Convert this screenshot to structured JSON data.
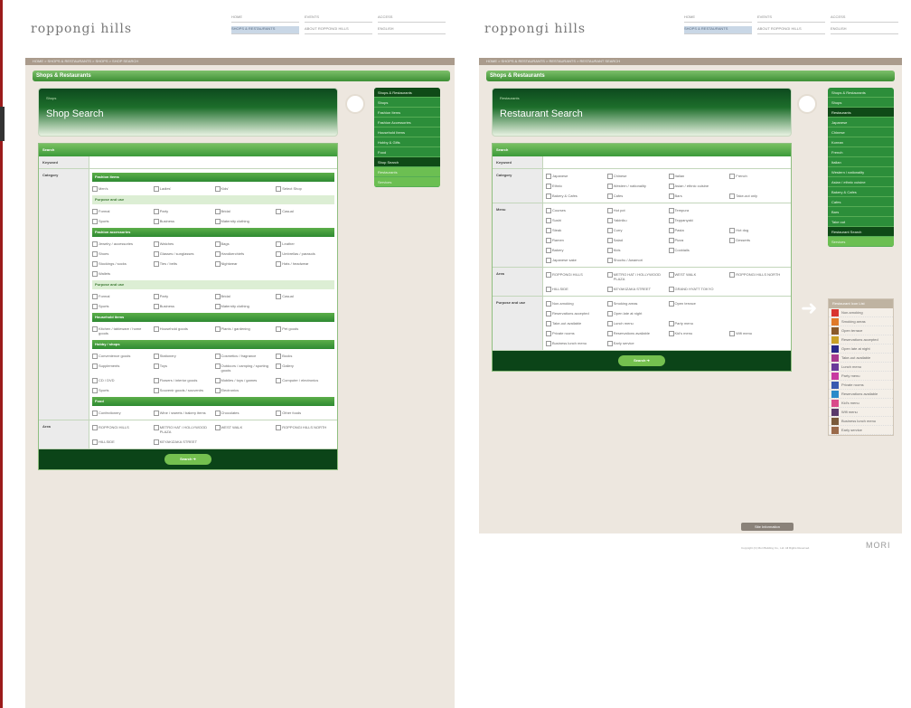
{
  "pageA": {
    "logo": "roppongi hills",
    "topnav": [
      "HOME",
      "EVENTS",
      "ACCESS",
      "SHOPS & RESTAURANTS",
      "ABOUT ROPPONGI HILLS",
      "ENGLISH"
    ],
    "breadcrumb": "HOME > SHOPS & RESTAURANTS > SHOPS > SHOP SEARCH",
    "band": "Shops & Restaurants",
    "hero_crumb": "Shops",
    "hero_title": "Shop Search",
    "menu": [
      {
        "label": "Shops & Restaurants",
        "state": "sel"
      },
      {
        "label": "Shops",
        "state": ""
      },
      {
        "label": "Fashion Items",
        "state": ""
      },
      {
        "label": "Fashion Accessories",
        "state": ""
      },
      {
        "label": "Household Items",
        "state": ""
      },
      {
        "label": "Hobby & Gifts",
        "state": ""
      },
      {
        "label": "Food",
        "state": ""
      },
      {
        "label": "Shop Search",
        "state": "sel"
      },
      {
        "label": "Restaurants",
        "state": "alt"
      },
      {
        "label": "Services",
        "state": "alt"
      }
    ],
    "form_head": "Search",
    "keyword_label": "Keyword",
    "category_label": "Category",
    "area_label": "Area",
    "groups": [
      {
        "name": "Fashion items",
        "light": false,
        "items": [
          "Men's",
          "Ladies'",
          "Kids'",
          "Select Shop"
        ]
      },
      {
        "name": "Purpose and use",
        "light": true,
        "items": [
          "Formal",
          "Party",
          "Bridal",
          "Casual",
          "Sports",
          "Business",
          "Maternity clothing"
        ]
      },
      {
        "name": "Fashion accessories",
        "light": false,
        "items": [
          "Jewelry / accessories",
          "Watches",
          "Bags",
          "Leather",
          "Shoes",
          "Glasses / sunglasses",
          "Handkerchiefs",
          "Umbrellas / parasols",
          "Stockings / socks",
          "Ties / belts",
          "Nightwear",
          "Hats / headwear",
          "Wallets"
        ]
      },
      {
        "name": "Purpose and use",
        "light": true,
        "items": [
          "Formal",
          "Party",
          "Bridal",
          "Casual",
          "Sports",
          "Business",
          "Maternity clothing"
        ]
      },
      {
        "name": "Household items",
        "light": false,
        "items": [
          "Kitchen / tableware / home goods",
          "Household goods",
          "Plants / gardening",
          "Pet goods"
        ]
      },
      {
        "name": "Hobby / shops",
        "light": false,
        "items": [
          "Convenience goods",
          "Stationery",
          "Cosmetics / fragrance",
          "Books",
          "Supplements",
          "Toys",
          "Outdoors / camping / sporting goods",
          "Gallery",
          "CD / DVD",
          "Flowers / interior goods",
          "Mobiles / toys / games",
          "Computer / electronics",
          "Sports",
          "Souvenir goods / souvenirs",
          "Electronics"
        ]
      },
      {
        "name": "Food",
        "light": false,
        "items": [
          "Confectionery",
          "Wine / sweets / bakery items",
          "Chocolates",
          "Other foods"
        ]
      }
    ],
    "areas": [
      "ROPPONGI HILLS",
      "METRO HAT / HOLLYWOOD PLAZA",
      "WEST WALK",
      "ROPPONGI HILLS NORTH",
      "HILLSIDE",
      "KEYAKIZAKA STREET"
    ],
    "search_btn": "Search  ➔"
  },
  "pageB": {
    "logo": "roppongi hills",
    "topnav": [
      "HOME",
      "EVENTS",
      "ACCESS",
      "SHOPS & RESTAURANTS",
      "ABOUT ROPPONGI HILLS",
      "ENGLISH"
    ],
    "breadcrumb": "HOME > SHOPS & RESTAURANTS > RESTAURANTS > RESTAURANT SEARCH",
    "band": "Shops & Restaurants",
    "hero_crumb": "Restaurants",
    "hero_title": "Restaurant Search",
    "menu": [
      {
        "label": "Shops & Restaurants",
        "state": ""
      },
      {
        "label": "Shops",
        "state": ""
      },
      {
        "label": "Restaurants",
        "state": "sel"
      },
      {
        "label": "Japanese",
        "state": ""
      },
      {
        "label": "Chinese",
        "state": ""
      },
      {
        "label": "Korean",
        "state": ""
      },
      {
        "label": "French",
        "state": ""
      },
      {
        "label": "Italian",
        "state": ""
      },
      {
        "label": "Western / nationality",
        "state": ""
      },
      {
        "label": "Asian / ethnic cuisine",
        "state": ""
      },
      {
        "label": "Bakery & Cafes",
        "state": ""
      },
      {
        "label": "Cafes",
        "state": ""
      },
      {
        "label": "Bars",
        "state": ""
      },
      {
        "label": "Take out",
        "state": ""
      },
      {
        "label": "Restaurant Search",
        "state": "sel"
      },
      {
        "label": "Services",
        "state": "alt"
      }
    ],
    "form_head": "Search",
    "keyword_label": "Keyword",
    "category_label": "Category",
    "menu_label": "Menu",
    "area_label": "Area",
    "purpose_label": "Purpose and use",
    "categories": [
      "Japanese",
      "Chinese",
      "Italian",
      "French",
      "Ethnic",
      "Western / nationality",
      "Asian / ethnic cuisine",
      "",
      "Bakery & Cafes",
      "Cafes",
      "Bars",
      "Take-out only"
    ],
    "menus": [
      "Courses",
      "Hot pot",
      "Tempura",
      "",
      "Sushi",
      "Yakiniku",
      "Teppanyaki",
      "",
      "Steak",
      "Curry",
      "Pasta",
      "Hot dog",
      "Ramen",
      "Salad",
      "Pizza",
      "Desserts",
      "Bakery",
      "Kids",
      "Cocktails",
      "",
      "Japanese sake",
      "Shochu / Awamori",
      "",
      ""
    ],
    "areas": [
      "ROPPONGI HILLS",
      "METRO HAT / HOLLYWOOD PLAZA",
      "WEST WALK",
      "ROPPONGI HILLS NORTH",
      "HILLSIDE",
      "KEYAKIZAKA STREET",
      "GRAND HYATT TOKYO",
      ""
    ],
    "purposes": [
      "Non-smoking",
      "Smoking areas",
      "Open terrace",
      "",
      "Reservations accepted",
      "Open late at night",
      "",
      "",
      "Take-out available",
      "Lunch menu",
      "Party menu",
      "",
      "Private rooms",
      "Reservations available",
      "Kid's menu",
      "Wifi menu",
      "Business lunch menu",
      "Early service",
      "",
      ""
    ],
    "search_btn": "Search  ➔",
    "legend_head": "Restaurant Icon List",
    "legend": [
      {
        "label": "Non-smoking",
        "color": "#d9352f"
      },
      {
        "label": "Smoking areas",
        "color": "#e07a2a"
      },
      {
        "label": "Open terrace",
        "color": "#8a5a2a"
      },
      {
        "label": "Reservations accepted",
        "color": "#c9a127"
      },
      {
        "label": "Open late at night",
        "color": "#2a2a8a"
      },
      {
        "label": "Take-out available",
        "color": "#a83a8f"
      },
      {
        "label": "Lunch menu",
        "color": "#6a3a9a"
      },
      {
        "label": "Party menu",
        "color": "#c83aa0"
      },
      {
        "label": "Private rooms",
        "color": "#3a5ab0"
      },
      {
        "label": "Reservations available",
        "color": "#2a8ac9"
      },
      {
        "label": "Kid's menu",
        "color": "#d94a8a"
      },
      {
        "label": "Wifi menu",
        "color": "#5a3a6a"
      },
      {
        "label": "Business lunch menu",
        "color": "#7a5a3a"
      },
      {
        "label": "Early service",
        "color": "#9a6a4a"
      }
    ],
    "footer_btn": "Site Information",
    "footer_copy": "Copyright (C) Mori Building Co., Ltd. All Rights Reserved.",
    "footer_logo": "MORI"
  }
}
